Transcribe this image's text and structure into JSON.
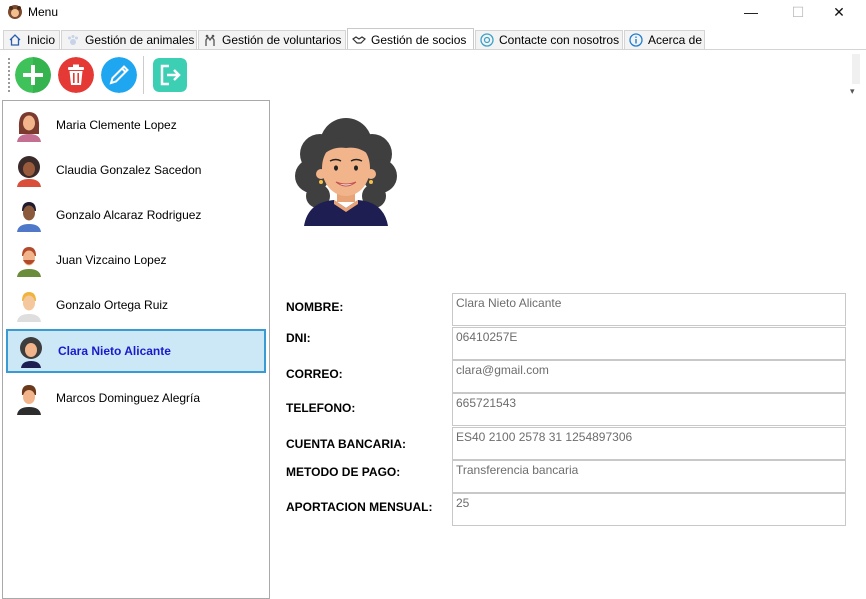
{
  "window": {
    "title": "Menu",
    "minimize_glyph": "—",
    "maximize_glyph": "☐",
    "close_glyph": "✕"
  },
  "tabs": [
    {
      "label": "Inicio",
      "icon": "home-icon"
    },
    {
      "label": "Gestión de animales",
      "icon": "paw-icon"
    },
    {
      "label": "Gestión de voluntarios",
      "icon": "volunteers-icon"
    },
    {
      "label": "Gestión de socios",
      "icon": "handshake-icon",
      "active": true
    },
    {
      "label": "Contacte con nosotros",
      "icon": "contact-icon"
    },
    {
      "label": "Acerca de",
      "icon": "info-icon"
    }
  ],
  "toolbar": {
    "add": {
      "icon": "add-icon",
      "color": "#3fc25a"
    },
    "delete": {
      "icon": "trash-icon",
      "color": "#e53935"
    },
    "edit": {
      "icon": "pencil-icon",
      "color": "#1ea7f0"
    },
    "logout": {
      "icon": "exit-icon",
      "color": "#3ccfb4"
    }
  },
  "members": [
    {
      "name": "Maria Clemente Lopez",
      "avatar": "woman-long-hair-avatar"
    },
    {
      "name": "Claudia Gonzalez Sacedon",
      "avatar": "woman-curly-hair-avatar"
    },
    {
      "name": "Gonzalo Alcaraz Rodriguez",
      "avatar": "man-dark-avatar"
    },
    {
      "name": "Juan Vizcaino Lopez",
      "avatar": "man-beard-avatar"
    },
    {
      "name": "Gonzalo Ortega Ruiz",
      "avatar": "man-blond-avatar"
    },
    {
      "name": "Clara Nieto Alicante",
      "avatar": "woman-curly-avatar",
      "selected": true
    },
    {
      "name": "Marcos Dominguez Alegría",
      "avatar": "man-brown-hair-avatar"
    }
  ],
  "detail": {
    "fields": [
      {
        "label": "NOMBRE:",
        "value": "Clara Nieto Alicante"
      },
      {
        "label": "DNI:",
        "value": "06410257E"
      },
      {
        "label": "CORREO:",
        "value": "clara@gmail.com"
      },
      {
        "label": "TELEFONO:",
        "value": "665721543"
      },
      {
        "label": "CUENTA BANCARIA:",
        "value": "ES40 2100 2578 31 1254897306"
      },
      {
        "label": "METODO DE PAGO:",
        "value": "Transferencia bancaria"
      },
      {
        "label": "APORTACION MENSUAL:",
        "value": "25"
      }
    ]
  },
  "colors": {
    "selection_bg": "#cce8f6",
    "selection_border": "#3a9bd2",
    "selection_text": "#1a1acc"
  }
}
